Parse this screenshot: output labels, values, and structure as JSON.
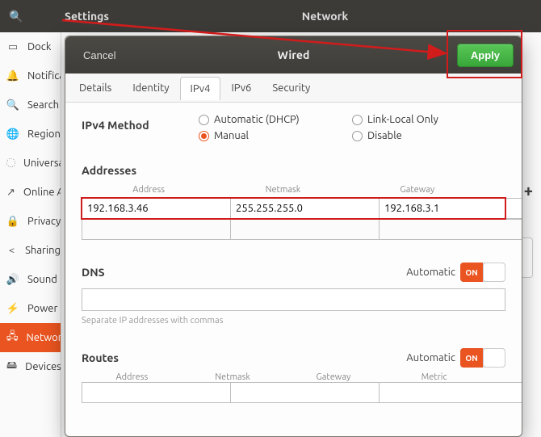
{
  "bgHeader": {
    "settings": "Settings",
    "network": "Network"
  },
  "sidebar": {
    "items": [
      {
        "icon": "▭",
        "label": "Dock"
      },
      {
        "icon": "🔔",
        "label": "Notifications"
      },
      {
        "icon": "🔍",
        "label": "Search"
      },
      {
        "icon": "🌐",
        "label": "Region & Language"
      },
      {
        "icon": "◌",
        "label": "Universal Access"
      },
      {
        "icon": "↗",
        "label": "Online Accounts"
      },
      {
        "icon": "🔒",
        "label": "Privacy"
      },
      {
        "icon": "<",
        "label": "Sharing"
      },
      {
        "icon": "🔊",
        "label": "Sound"
      },
      {
        "icon": "⚡",
        "label": "Power"
      },
      {
        "icon": "🖧",
        "label": "Network"
      },
      {
        "icon": "🖴",
        "label": "Devices"
      }
    ],
    "activeIndex": 10
  },
  "bgContent": {
    "sectionLabel": "",
    "plus": "+"
  },
  "dialog": {
    "cancel": "Cancel",
    "apply": "Apply",
    "title": "Wired",
    "tabs": [
      "Details",
      "Identity",
      "IPv4",
      "IPv6",
      "Security"
    ],
    "activeTab": 2,
    "ipv4": {
      "methodLabel": "IPv4 Method",
      "methods": {
        "auto": "Automatic (DHCP)",
        "manual": "Manual",
        "linklocal": "Link-Local Only",
        "disable": "Disable",
        "selected": "manual"
      },
      "addresses": {
        "title": "Addresses",
        "headers": {
          "address": "Address",
          "netmask": "Netmask",
          "gateway": "Gateway"
        },
        "rows": [
          {
            "address": "192.168.3.46",
            "netmask": "255.255.255.0",
            "gateway": "192.168.3.1"
          },
          {
            "address": "",
            "netmask": "",
            "gateway": ""
          }
        ]
      },
      "dns": {
        "title": "DNS",
        "automatic": "Automatic",
        "on": "ON",
        "value": "",
        "hint": "Separate IP addresses with commas"
      },
      "routes": {
        "title": "Routes",
        "automatic": "Automatic",
        "on": "ON",
        "headers": {
          "address": "Address",
          "netmask": "Netmask",
          "gateway": "Gateway",
          "metric": "Metric"
        },
        "row": {
          "address": "",
          "netmask": "",
          "gateway": "",
          "metric": ""
        }
      }
    }
  }
}
